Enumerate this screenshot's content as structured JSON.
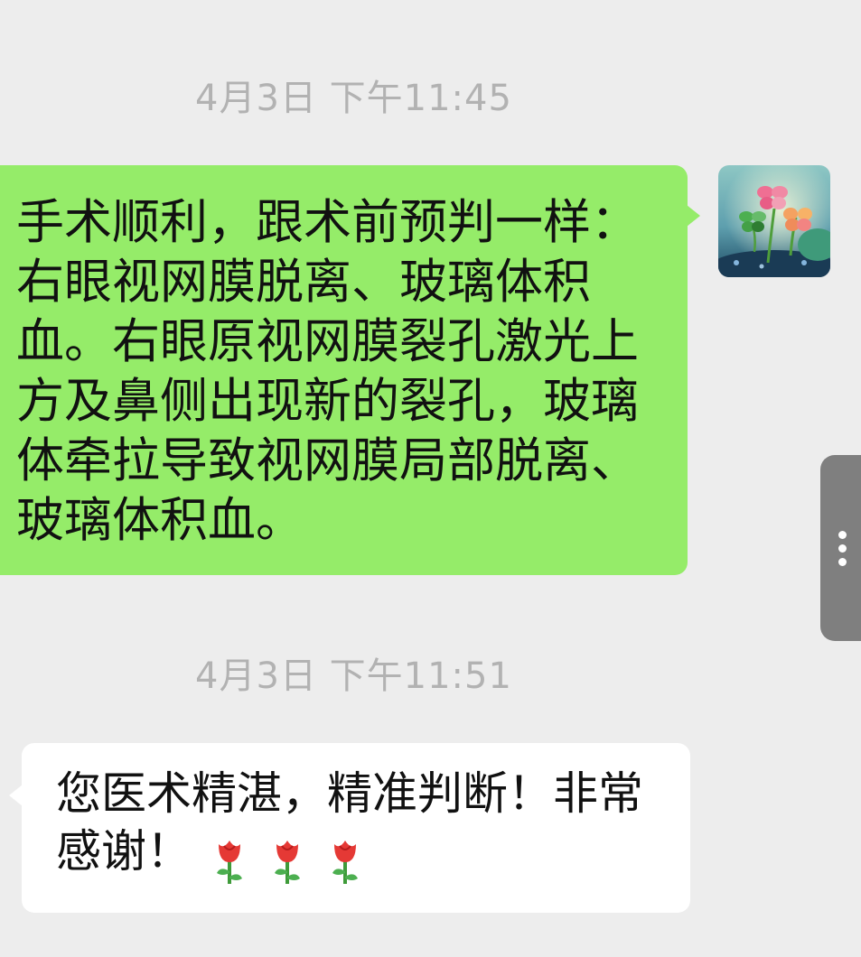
{
  "conversation": {
    "timestamps": [
      "4月3日 下午11:45",
      "4月3日 下午11:51"
    ],
    "messages": [
      {
        "direction": "sent",
        "text": "手术顺利，跟术前预判一样：右眼视网膜脱离、玻璃体积血。右眼原视网膜裂孔激光上方及鼻侧出现新的裂孔，玻璃体牵拉导致视网膜局部脱离、玻璃体积血。",
        "bubble_color": "#95ec69"
      },
      {
        "direction": "received",
        "text": "您医术精湛，精准判断！非常感谢！",
        "emoji": [
          "rose-emoji",
          "rose-emoji",
          "rose-emoji"
        ],
        "bubble_color": "#ffffff"
      }
    ]
  },
  "avatar": {
    "icon": "four-leaf-clover-avatar"
  },
  "side_handle": {
    "icon": "more-vertical-icon"
  },
  "colors": {
    "background": "#ededed",
    "timestamp": "#b2b2b2",
    "sent_bubble": "#95ec69",
    "received_bubble": "#ffffff"
  }
}
